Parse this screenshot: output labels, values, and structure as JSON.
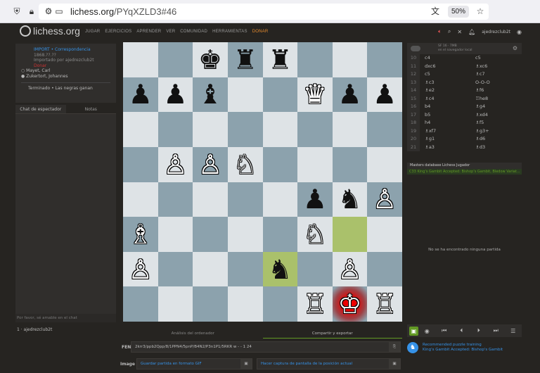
{
  "browser": {
    "url_domain": "lichess.org",
    "url_path": "/PYqXZLD3#46",
    "zoom": "50%"
  },
  "header": {
    "logo": "lichess.org",
    "nav": [
      "JUGAR",
      "EJERCICIOS",
      "APRENDER",
      "VER",
      "COMUNIDAD",
      "HERRAMIENTAS"
    ],
    "donate": "DONAR",
    "username": "ajedrezclub2t"
  },
  "game": {
    "type": "IMPORT • Correspondencia",
    "date": "1868.??.??",
    "imported_by": "Importado por ajedrezclub2t",
    "tag": "Donar",
    "white": "Mayet, Carl",
    "black": "Zukertort, Johannes",
    "result": "Terminado • Las negras ganan"
  },
  "chat": {
    "tab_chat": "Chat de espectador",
    "tab_notes": "Notas",
    "placeholder": "Por favor, sé amable en el chat"
  },
  "spectator": "1 · ajedrezclub2t",
  "board": {
    "ranks": [
      [
        "",
        "",
        "♚",
        "♜",
        "♜",
        "",
        "",
        ""
      ],
      [
        "♟",
        "♟",
        "♝",
        "",
        "",
        "♛",
        "♟",
        "♟"
      ],
      [
        "",
        "",
        "",
        "",
        "",
        "",
        "",
        ""
      ],
      [
        "",
        "♙",
        "♙",
        "♘",
        "",
        "",
        "",
        ""
      ],
      [
        "",
        "",
        "",
        "",
        "",
        "♟",
        "♞",
        "♙"
      ],
      [
        "♗",
        "",
        "",
        "",
        "",
        "♘",
        "",
        ""
      ],
      [
        "♙",
        "",
        "",
        "",
        "♞",
        "",
        "♙",
        ""
      ],
      [
        "",
        "",
        "",
        "",
        "",
        "♖",
        "♔",
        "♖"
      ]
    ],
    "colors": [
      [
        "",
        "",
        "b",
        "b",
        "b",
        "",
        "",
        ""
      ],
      [
        "b",
        "b",
        "b",
        "",
        "",
        "w",
        "b",
        "b"
      ],
      [
        "",
        "",
        "",
        "",
        "",
        "",
        "",
        ""
      ],
      [
        "",
        "w",
        "w",
        "w",
        "",
        "",
        "",
        ""
      ],
      [
        "",
        "",
        "",
        "",
        "",
        "b",
        "b",
        "w"
      ],
      [
        "w",
        "",
        "",
        "",
        "",
        "w",
        "",
        ""
      ],
      [
        "w",
        "",
        "",
        "",
        "b",
        "",
        "w",
        ""
      ],
      [
        "",
        "",
        "",
        "",
        "",
        "w",
        "w",
        "w"
      ]
    ]
  },
  "engine": {
    "label": "SF 16 · 7MB",
    "status": "en el navegador local"
  },
  "moves": [
    {
      "n": "10",
      "w": "c4",
      "b": "c5"
    },
    {
      "n": "11",
      "w": "dxc6",
      "b": "♗xc6"
    },
    {
      "n": "12",
      "w": "c5",
      "b": "♗c7"
    },
    {
      "n": "13",
      "w": "♗c3",
      "b": "O-O-O"
    },
    {
      "n": "14",
      "w": "♗e2",
      "b": "♗f6"
    },
    {
      "n": "15",
      "w": "♗c4",
      "b": "♖he8"
    },
    {
      "n": "16",
      "w": "b4",
      "b": "♗g4"
    },
    {
      "n": "17",
      "w": "b5",
      "b": "♗xd4"
    },
    {
      "n": "18",
      "w": "h4",
      "b": "♗f5"
    },
    {
      "n": "19",
      "w": "♗xf7",
      "b": "♗g3+"
    },
    {
      "n": "20",
      "w": "♗g1",
      "b": "♗d6"
    },
    {
      "n": "21",
      "w": "♗a3",
      "b": "♗d3"
    }
  ],
  "explorer": {
    "tabs": "Masters database  Lichess  Jugador",
    "opening": "C33 King's Gambit Accepted: Bishop's Gambit, Bledow Variat...",
    "empty": "No se ha encontrado ninguna partida"
  },
  "under": {
    "tab1": "Análisis del ordenador",
    "tab2": "Compartir y exportar",
    "fen_label": "FEN",
    "fen": "2krr3/ppb2Qpp/8/1PPN4/5pnP/B4N2/P3n1P1/5RKR w - - 1 24",
    "image_label": "Image",
    "gif": "Guardar partida en formato GIF",
    "screenshot": "Hacer captura de pantalla de la posición actual"
  },
  "puzzle": {
    "line1": "Recommended puzzle training",
    "line2": "King's Gambit Accepted: Bishop's Gambit"
  }
}
